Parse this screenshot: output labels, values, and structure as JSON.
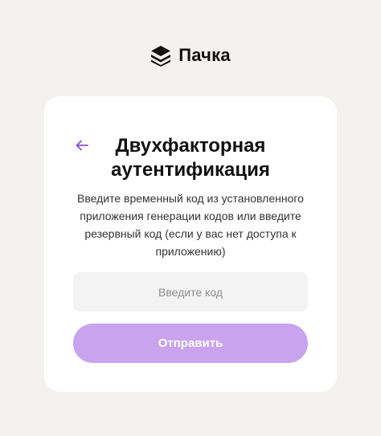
{
  "brand": {
    "name": "Пачка",
    "icon": "stacked-layers-logo-icon"
  },
  "auth": {
    "back_icon": "arrow-left-icon",
    "title_line1": "Двухфакторная",
    "title_line2": "аутентификация",
    "description": "Введите временный код из установленного приложения генерации кодов или введите резервный код (если у вас нет доступа к приложению)",
    "code_input": {
      "value": "",
      "placeholder": "Введите код"
    },
    "submit_label": "Отправить"
  },
  "colors": {
    "accent": "#8a4fd1",
    "button_disabled": "#c9a3ee",
    "background": "#f3f2f0"
  }
}
